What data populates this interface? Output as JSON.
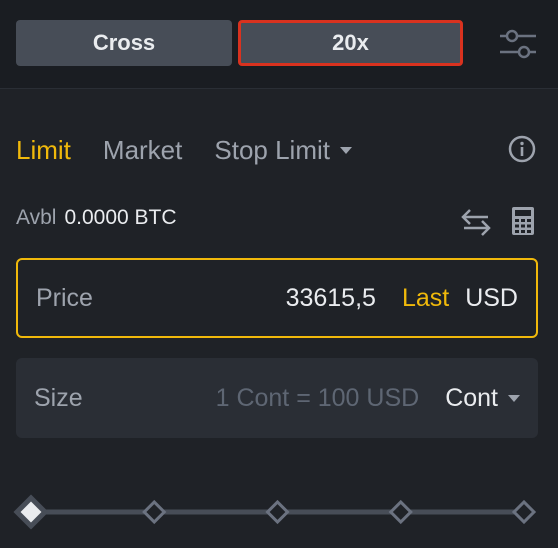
{
  "header": {
    "margin_mode_label": "Cross",
    "leverage_label": "20x"
  },
  "order_tabs": [
    {
      "label": "Limit",
      "active": true
    },
    {
      "label": "Market",
      "active": false
    },
    {
      "label": "Stop Limit",
      "active": false,
      "has_dropdown": true
    }
  ],
  "available": {
    "label": "Avbl",
    "value": "0.0000 BTC"
  },
  "price_field": {
    "label": "Price",
    "value": "33615,5",
    "last_label": "Last",
    "unit": "USD"
  },
  "size_field": {
    "label": "Size",
    "hint": "1 Cont = 100 USD",
    "unit": "Cont"
  },
  "slider": {
    "value_fraction": 0,
    "stops": 5
  },
  "colors": {
    "accent": "#f0b90b",
    "highlight_border": "#d9321f",
    "background": "#1f2227"
  },
  "icons": [
    "settings-sliders-icon",
    "info-icon",
    "swap-icon",
    "calculator-icon"
  ]
}
